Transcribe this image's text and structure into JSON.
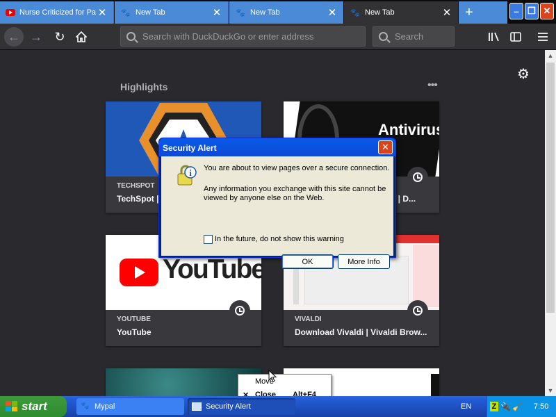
{
  "tabs": [
    {
      "label": "Nurse Criticized for Pa",
      "favicon": "youtube-icon",
      "active": false
    },
    {
      "label": "New Tab",
      "favicon": "mypal-icon",
      "active": false
    },
    {
      "label": "New Tab",
      "favicon": "mypal-icon",
      "active": false
    },
    {
      "label": "New Tab",
      "favicon": "mypal-icon",
      "active": true
    }
  ],
  "toolbar": {
    "url_placeholder": "Search with DuckDuckGo or enter address",
    "search_placeholder": "Search"
  },
  "highlights": {
    "title": "Highlights",
    "cards": [
      {
        "site": "TECHSPOT",
        "title": "TechSpot |"
      },
      {
        "site": "",
        "title": "er | D..."
      },
      {
        "site": "YOUTUBE",
        "title": "YouTube"
      },
      {
        "site": "VIVALDI",
        "title": "Download Vivaldi | Vivaldi Brow..."
      }
    ]
  },
  "thumb_text": {
    "antivirus": "Antivirus",
    "youtube": "YouTube"
  },
  "dialog": {
    "title": "Security Alert",
    "line1": "You are about to view pages over a secure connection.",
    "line2": "Any information you exchange with this site cannot be",
    "line3": "viewed by anyone else on the Web.",
    "checkbox_label": "In the future, do not show this warning",
    "ok_label": "OK",
    "more_label": "More Info"
  },
  "context_menu": {
    "move": "Move",
    "close": "Close",
    "close_shortcut": "Alt+F4"
  },
  "taskbar": {
    "start": "start",
    "items": [
      "Mypal",
      "Security Alert"
    ],
    "language": "EN",
    "clock": "7:50"
  },
  "colors": {
    "xp_blue": "#245edb",
    "start_green": "#2e8b2e",
    "firefox_dark": "#2a2a2e",
    "youtube_red": "#ff0000"
  }
}
